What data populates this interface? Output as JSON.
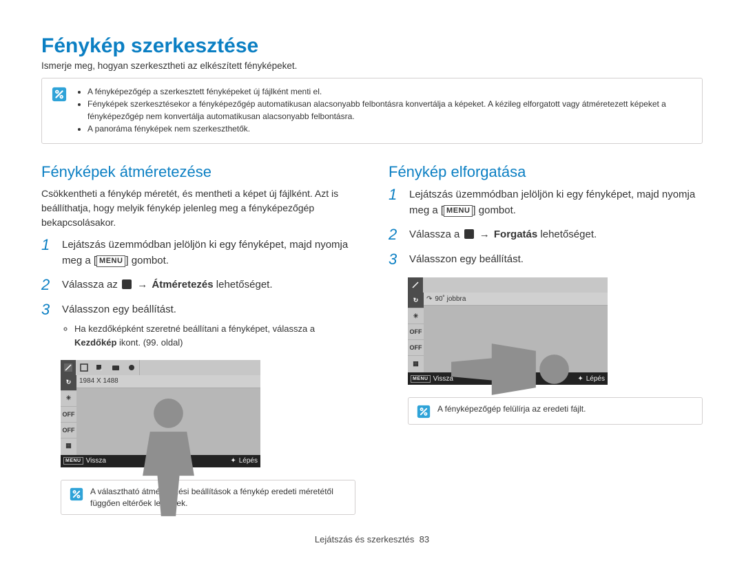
{
  "title": "Fénykép szerkesztése",
  "intro": "Ismerje meg, hogyan szerkesztheti az elkészített fényképeket.",
  "top_note": {
    "items": [
      "A fényképezőgép a szerkesztett fényképeket új fájlként menti el.",
      "Fényképek szerkesztésekor a fényképezőgép automatikusan alacsonyabb felbontásra konvertálja a képeket. A kézileg elforgatott vagy átméretezett képeket a fényképezőgép nem konvertálja automatikusan alacsonyabb felbontásra.",
      "A panoráma fényképek nem szerkeszthetők."
    ]
  },
  "left": {
    "heading": "Fényképek átméretezése",
    "body": "Csökkentheti a fénykép méretét, és mentheti a képet új fájlként. Azt is beállíthatja, hogy melyik fénykép jelenleg meg a fényképezőgép bekapcsolásakor.",
    "step1_a": "Lejátszás üzemmódban jelöljön ki egy fényképet, majd nyomja meg a [",
    "step1_b": "MENU",
    "step1_c": "] gombot.",
    "step2_a": "Válassza az ",
    "step2_arrow": "→",
    "step2_b": "Átméretezés",
    "step2_c": " lehetőséget.",
    "step3": "Válasszon egy beállítást.",
    "sub_a": "Ha kezdőképként szeretné beállítani a fényképet, válassza a ",
    "sub_b": "Kezdőkép",
    "sub_c": " ikont. (99. oldal)",
    "preview_label": "1984 X 1488",
    "footer_back": "Vissza",
    "footer_enter": "Lépés",
    "small_note": "A választható átméretezési beállítások a fénykép eredeti méretétől függően eltérőek lehetnek."
  },
  "right": {
    "heading": "Fénykép elforgatása",
    "step1_a": "Lejátszás üzemmódban jelöljön ki egy fényképet, majd nyomja meg a [",
    "step1_b": "MENU",
    "step1_c": "] gombot.",
    "step2_a": "Válassza a ",
    "step2_arrow": "→",
    "step2_b": "Forgatás",
    "step2_c": " lehetőséget.",
    "step3": "Válasszon egy beállítást.",
    "preview_label": "90˚ jobbra",
    "footer_back": "Vissza",
    "footer_enter": "Lépés",
    "small_note": "A fényképezőgép felülírja az eredeti fájlt."
  },
  "footer": {
    "section": "Lejátszás és szerkesztés",
    "page": "83"
  }
}
